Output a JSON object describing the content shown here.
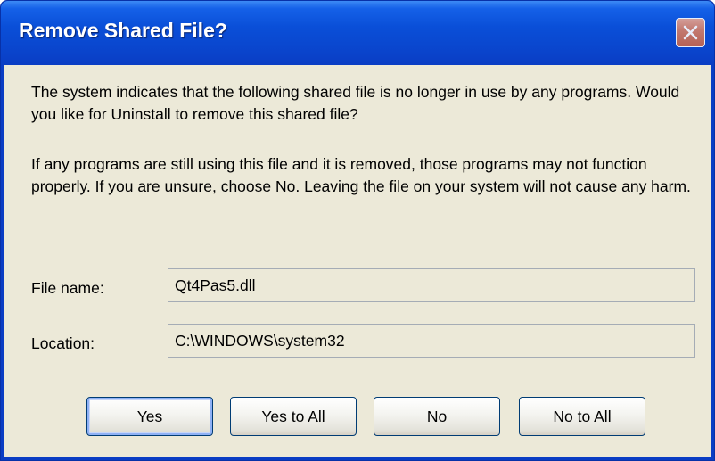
{
  "window": {
    "title": "Remove Shared File?"
  },
  "message": {
    "paragraph1": "The system indicates that the following shared file is no longer in use by any programs. Would you like for Uninstall to remove this shared file?",
    "paragraph2": "If any programs are still using this file and it is removed, those programs may not function properly. If you are unsure, choose No. Leaving the file on your system will not cause any harm."
  },
  "fields": {
    "file_name_label": "File name:",
    "file_name_value": "Qt4Pas5.dll",
    "location_label": "Location:",
    "location_value": "C:\\WINDOWS\\system32"
  },
  "buttons": {
    "yes": "Yes",
    "yes_to_all": "Yes to All",
    "no": "No",
    "no_to_all": "No to All"
  },
  "colors": {
    "titlebar": "#0A4FD8",
    "client_bg": "#ECE9D8",
    "close_button": "#D77F66",
    "button_border": "#003C74"
  },
  "icons": {
    "close": "close-icon"
  }
}
